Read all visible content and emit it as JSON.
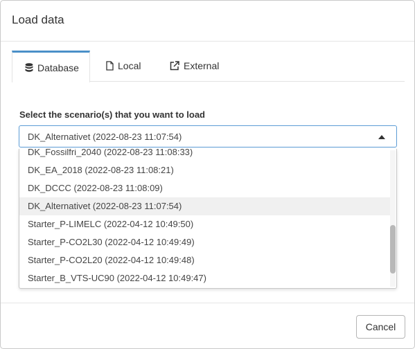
{
  "dialog": {
    "title": "Load data"
  },
  "tabs": [
    {
      "label": "Database",
      "icon": "database-icon",
      "active": true
    },
    {
      "label": "Local",
      "icon": "file-icon",
      "active": false
    },
    {
      "label": "External",
      "icon": "external-link-icon",
      "active": false
    }
  ],
  "form": {
    "label": "Select the scenario(s) that you want to load",
    "selected_value": "DK_Alternativet (2022-08-23 11:07:54)"
  },
  "options": [
    "DK_Fossilfri_2040 (2022-08-23 11:08:33)",
    "DK_EA_2018 (2022-08-23 11:08:21)",
    "DK_DCCC (2022-08-23 11:08:09)",
    "DK_Alternativet (2022-08-23 11:07:54)",
    "Starter_P-LIMELC (2022-04-12 10:49:50)",
    "Starter_P-CO2L30 (2022-04-12 10:49:49)",
    "Starter_P-CO2L20 (2022-04-12 10:49:48)",
    "Starter_B_VTS-UC90 (2022-04-12 10:49:47)"
  ],
  "footer": {
    "cancel_label": "Cancel"
  },
  "colors": {
    "accent": "#4a90c8",
    "select_border": "#5b9bd5",
    "selected_row": "#f0f0f0"
  }
}
